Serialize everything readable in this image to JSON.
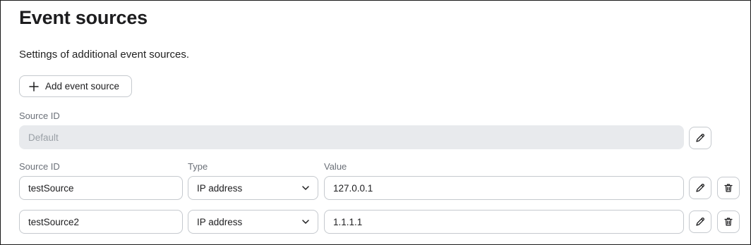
{
  "header": {
    "title": "Event sources",
    "subtitle": "Settings of additional event sources."
  },
  "toolbar": {
    "add_label": "Add event source"
  },
  "default_source": {
    "label": "Source ID",
    "value": "Default"
  },
  "columns": {
    "source_id": "Source ID",
    "type": "Type",
    "value": "Value"
  },
  "rows": [
    {
      "source_id": "testSource",
      "type": "IP address",
      "value": "127.0.0.1"
    },
    {
      "source_id": "testSource2",
      "type": "IP address",
      "value": "1.1.1.1"
    }
  ],
  "icons": {
    "add": "plus-icon",
    "edit": "pencil-icon",
    "delete": "trash-icon",
    "dropdown": "chevron-down-icon"
  }
}
